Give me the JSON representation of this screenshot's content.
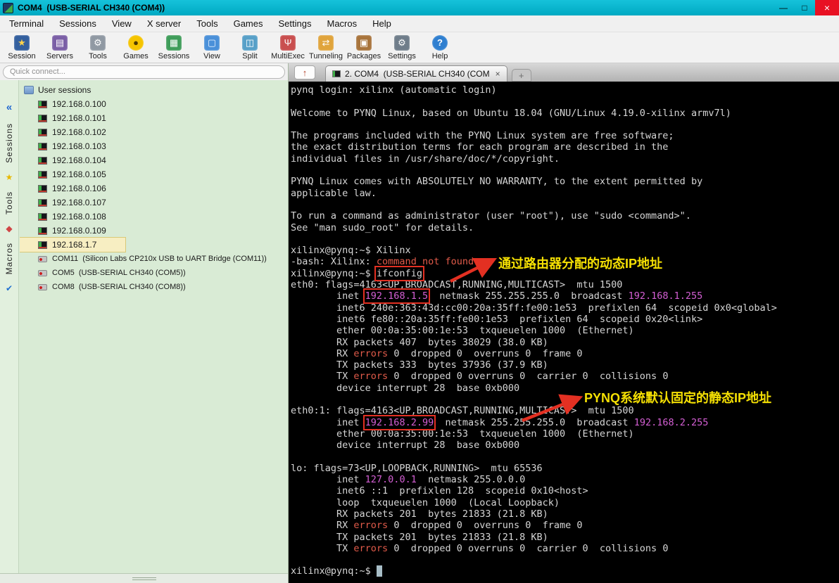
{
  "window": {
    "title": "COM4  (USB-SERIAL CH340 (COM4))",
    "controls": {
      "minimize": "—",
      "maximize": "□",
      "close": "×"
    }
  },
  "menu": {
    "items": [
      "Terminal",
      "Sessions",
      "View",
      "X server",
      "Tools",
      "Games",
      "Settings",
      "Macros",
      "Help"
    ]
  },
  "toolbar": {
    "items": [
      {
        "id": "session",
        "label": "Session",
        "glyph": "★"
      },
      {
        "id": "servers",
        "label": "Servers",
        "glyph": "▤"
      },
      {
        "id": "tools",
        "label": "Tools",
        "glyph": "⚙"
      },
      {
        "id": "games",
        "label": "Games",
        "glyph": "●"
      },
      {
        "id": "sessions",
        "label": "Sessions",
        "glyph": "▦"
      },
      {
        "id": "view",
        "label": "View",
        "glyph": "▢"
      },
      {
        "id": "split",
        "label": "Split",
        "glyph": "◫"
      },
      {
        "id": "multiexec",
        "label": "MultiExec",
        "glyph": "Ψ"
      },
      {
        "id": "tunneling",
        "label": "Tunneling",
        "glyph": "⇄"
      },
      {
        "id": "packages",
        "label": "Packages",
        "glyph": "▣"
      },
      {
        "id": "settings",
        "label": "Settings",
        "glyph": "⚙"
      },
      {
        "id": "help",
        "label": "Help",
        "glyph": "?"
      }
    ]
  },
  "sidebar": {
    "quick_connect_placeholder": "Quick connect...",
    "collapse_glyph": "«",
    "vertical_tabs": [
      {
        "label": "Sessions",
        "glyph": "★"
      },
      {
        "label": "Tools",
        "glyph": "◆"
      },
      {
        "label": "Macros",
        "glyph": "✔"
      }
    ],
    "tree_root": "User sessions",
    "sessions": [
      "192.168.0.100",
      "192.168.0.101",
      "192.168.0.102",
      "192.168.0.103",
      "192.168.0.104",
      "192.168.0.105",
      "192.168.0.106",
      "192.168.0.107",
      "192.168.0.108",
      "192.168.0.109",
      "192.168.1.7"
    ],
    "selected_session": "192.168.1.7",
    "serial_sessions": [
      "COM11  (Silicon Labs CP210x USB to UART Bridge (COM11))",
      "COM5  (USB-SERIAL CH340 (COM5))",
      "COM8  (USB-SERIAL CH340 (COM8))"
    ]
  },
  "tab_bar": {
    "popout_glyph": "↑",
    "active_tab": "2. COM4  (USB-SERIAL CH340 (COM",
    "close_glyph": "×",
    "new_tab_glyph": "+"
  },
  "terminal": {
    "lines": [
      [
        {
          "t": "pynq login: xilinx (automatic login)"
        }
      ],
      [],
      [
        {
          "t": "Welcome to PYNQ Linux, based on Ubuntu 18.04 (GNU/Linux 4.19.0-xilinx armv7l)"
        }
      ],
      [],
      [
        {
          "t": "The programs included with the PYNQ Linux system are free software;"
        }
      ],
      [
        {
          "t": "the exact distribution terms for each program are described in the"
        }
      ],
      [
        {
          "t": "individual files in /usr/share/doc/*/copyright."
        }
      ],
      [],
      [
        {
          "t": "PYNQ Linux comes with ABSOLUTELY NO WARRANTY, to the extent permitted by"
        }
      ],
      [
        {
          "t": "applicable law."
        }
      ],
      [],
      [
        {
          "t": "To run a command as administrator (user \"root\"), use \"sudo <command>\"."
        }
      ],
      [
        {
          "t": "See \"man sudo_root\" for details."
        }
      ],
      [],
      [
        {
          "t": "xilinx@pynq:~$ Xilinx"
        }
      ],
      [
        {
          "t": "-bash: Xilinx: "
        },
        {
          "t": "command not found",
          "c": "r"
        }
      ],
      [
        {
          "t": "xilinx@pynq:~$ "
        },
        {
          "t": "ifconfig",
          "box": true
        }
      ],
      [
        {
          "t": "eth0: flags=4163<UP,BROADCAST,RUNNING,MULTICAST>  mtu 1500"
        }
      ],
      [
        {
          "t": "        inet "
        },
        {
          "t": "192.168.1.5",
          "c": "m",
          "box": true
        },
        {
          "t": "  netmask 255.255.255.0  broadcast "
        },
        {
          "t": "192.168.1.255",
          "c": "m"
        }
      ],
      [
        {
          "t": "        inet6 240e:363:43d:cc00:20a:35ff:fe00:1e53  prefixlen 64  scopeid 0x0<global>"
        }
      ],
      [
        {
          "t": "        inet6 fe80::20a:35ff:fe00:1e53  prefixlen 64  scopeid 0x20<link>"
        }
      ],
      [
        {
          "t": "        ether 00:0a:35:00:1e:53  txqueuelen 1000  (Ethernet)"
        }
      ],
      [
        {
          "t": "        RX packets 407  bytes 38029 (38.0 KB)"
        }
      ],
      [
        {
          "t": "        RX "
        },
        {
          "t": "errors",
          "c": "r"
        },
        {
          "t": " 0  dropped 0  overruns 0  frame 0"
        }
      ],
      [
        {
          "t": "        TX packets 333  bytes 37936 (37.9 KB)"
        }
      ],
      [
        {
          "t": "        TX "
        },
        {
          "t": "errors",
          "c": "r"
        },
        {
          "t": " 0  dropped 0 overruns 0  carrier 0  collisions 0"
        }
      ],
      [
        {
          "t": "        device interrupt 28  base 0xb000"
        }
      ],
      [],
      [
        {
          "t": "eth0:1: flags=4163<UP,BROADCAST,RUNNING,MULTICAST>  mtu 1500"
        }
      ],
      [
        {
          "t": "        inet "
        },
        {
          "t": "192.168.2.99",
          "c": "m",
          "box": true
        },
        {
          "t": "  netmask 255.255.255.0  broadcast "
        },
        {
          "t": "192.168.2.255",
          "c": "m"
        }
      ],
      [
        {
          "t": "        ether 00:0a:35:00:1e:53  txqueuelen 1000  (Ethernet)"
        }
      ],
      [
        {
          "t": "        device interrupt 28  base 0xb000"
        }
      ],
      [],
      [
        {
          "t": "lo: flags=73<UP,LOOPBACK,RUNNING>  mtu 65536"
        }
      ],
      [
        {
          "t": "        inet "
        },
        {
          "t": "127.0.0.1",
          "c": "m"
        },
        {
          "t": "  netmask 255.0.0.0"
        }
      ],
      [
        {
          "t": "        inet6 ::1  prefixlen 128  scopeid 0x10<host>"
        }
      ],
      [
        {
          "t": "        loop  txqueuelen 1000  (Local Loopback)"
        }
      ],
      [
        {
          "t": "        RX packets 201  bytes 21833 (21.8 KB)"
        }
      ],
      [
        {
          "t": "        RX "
        },
        {
          "t": "errors",
          "c": "r"
        },
        {
          "t": " 0  dropped 0  overruns 0  frame 0"
        }
      ],
      [
        {
          "t": "        TX packets 201  bytes 21833 (21.8 KB)"
        }
      ],
      [
        {
          "t": "        TX "
        },
        {
          "t": "errors",
          "c": "r"
        },
        {
          "t": " 0  dropped 0 overruns 0  carrier 0  collisions 0"
        }
      ],
      [],
      [
        {
          "t": "xilinx@pynq:~$ "
        },
        {
          "t": " ",
          "cursor": true
        }
      ]
    ]
  },
  "annotations": [
    {
      "text": "通过路由器分配的动态IP地址"
    },
    {
      "text": "PYNQ系统默认固定的静态IP地址"
    }
  ],
  "colors": {
    "titlebar": "#00b2ca",
    "terminal_bg": "#000000",
    "terminal_fg": "#d6d6d6",
    "error_red": "#e25b4a",
    "ip_magenta": "#d45fd4",
    "annotation_yellow": "#f5e003",
    "annotation_red": "#e33022",
    "sidebar_green": "#d9ebd5",
    "selected_session_bg": "#f7eec2"
  }
}
